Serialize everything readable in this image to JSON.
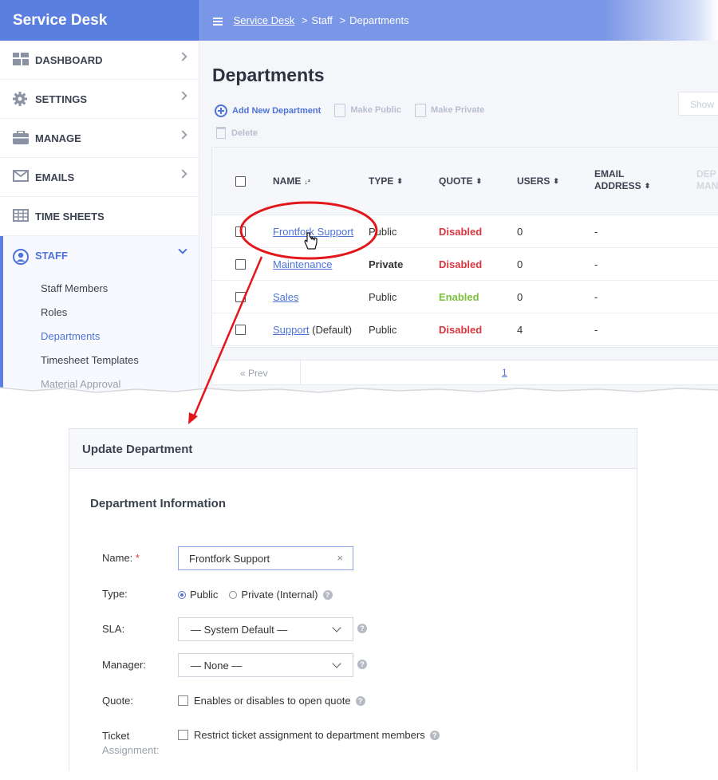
{
  "app": {
    "title": "Service Desk"
  },
  "breadcrumb": {
    "root": "Service Desk",
    "sep1": ">",
    "level1": "Staff",
    "sep2": ">",
    "level2": "Departments"
  },
  "sidebar": {
    "items": [
      {
        "label": "DASHBOARD",
        "icon": "dashboard-icon"
      },
      {
        "label": "SETTINGS",
        "icon": "gear-icon"
      },
      {
        "label": "MANAGE",
        "icon": "briefcase-icon"
      },
      {
        "label": "EMAILS",
        "icon": "envelope-icon"
      },
      {
        "label": "TIME SHEETS",
        "icon": "table-icon"
      },
      {
        "label": "STAFF",
        "icon": "user-circle-icon"
      }
    ],
    "staff_sub": [
      "Staff Members",
      "Roles",
      "Departments",
      "Timesheet Templates",
      "Material Approval"
    ]
  },
  "page": {
    "title": "Departments",
    "show_label": "Show"
  },
  "toolbar": {
    "add": "Add New Department",
    "make_public": "Make Public",
    "make_private": "Make Private",
    "delete": "Delete"
  },
  "table": {
    "headers": {
      "name": "NAME",
      "type": "TYPE",
      "quote": "QUOTE",
      "users": "USERS",
      "email_1": "EMAIL",
      "email_2": "ADDRESS",
      "dept_1": "DEP",
      "dept_2": "MAN"
    },
    "rows": [
      {
        "name": "Frontfork Support",
        "suffix": "",
        "type": "Public",
        "quote": "Disabled",
        "users": "0",
        "email": "-"
      },
      {
        "name": "Maintenance",
        "suffix": "",
        "type": "Private",
        "quote": "Disabled",
        "users": "0",
        "email": "-"
      },
      {
        "name": "Sales",
        "suffix": "",
        "type": "Public",
        "quote": "Enabled",
        "users": "0",
        "email": "-"
      },
      {
        "name": "Support",
        "suffix": "(Default)",
        "type": "Public",
        "quote": "Disabled",
        "users": "4",
        "email": "-"
      }
    ]
  },
  "pager": {
    "prev": "« Prev",
    "page": "1"
  },
  "colors": {
    "accent": "#5b7fe0",
    "disabled": "#d9363e",
    "enabled": "#7cbf3a",
    "annotation": "#e3161b"
  },
  "update_dept": {
    "title": "Update Department",
    "section": "Department Information",
    "name_label": "Name:",
    "required_mark": "*",
    "name_value": "Frontfork Support",
    "clear": "×",
    "type_label": "Type:",
    "type_public": "Public",
    "type_private": "Private (Internal)",
    "sla_label": "SLA:",
    "sla_value": "— System Default —",
    "manager_label": "Manager:",
    "manager_value": "— None —",
    "quote_label": "Quote:",
    "quote_text": "Enables or disables to open quote",
    "ticket_label_1": "Ticket",
    "ticket_label_2": "Assignment:",
    "ticket_text": "Restrict ticket assignment to department members",
    "help": "?"
  }
}
